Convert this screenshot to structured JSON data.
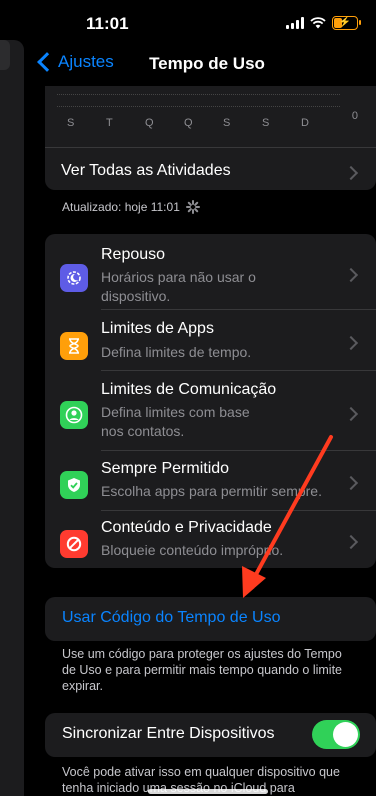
{
  "status": {
    "time": "11:01"
  },
  "nav": {
    "back_label": "Ajustes",
    "title": "Tempo de Uso"
  },
  "chart": {
    "days": [
      "S",
      "T",
      "Q",
      "Q",
      "S",
      "S",
      "D"
    ],
    "zero_label": "0"
  },
  "activities": {
    "label": "Ver Todas as Atividades"
  },
  "updated": {
    "text": "Atualizado: hoje 11:01"
  },
  "menu": [
    {
      "title": "Repouso",
      "subtitle": "Horários para não usar o dispositivo.",
      "icon": "moon-timer-icon",
      "color": "#5e5ce6"
    },
    {
      "title": "Limites de Apps",
      "subtitle": "Defina limites de tempo.",
      "icon": "hourglass-icon",
      "color": "#ff9f0a"
    },
    {
      "title": "Limites de Comunicação",
      "subtitle": "Defina limites com base nos contatos.",
      "icon": "person-circle-icon",
      "color": "#30d158"
    },
    {
      "title": "Sempre Permitido",
      "subtitle": "Escolha apps para permitir sempre.",
      "icon": "checkmark-shield-icon",
      "color": "#30d158"
    },
    {
      "title": "Conteúdo e Privacidade",
      "subtitle": "Bloqueie conteúdo impróprio.",
      "icon": "no-entry-icon",
      "color": "#ff3b30"
    }
  ],
  "passcode": {
    "link": "Usar Código do Tempo de Uso",
    "description": "Use um código para proteger os ajustes do Tempo de Uso e para permitir mais tempo quando o limite expirar."
  },
  "sync": {
    "label": "Sincronizar Entre Dispositivos",
    "enabled": true,
    "description": "Você pode ativar isso em qualquer dispositivo que tenha iniciado uma sessão no iCloud para"
  },
  "colors": {
    "accent": "#0a84ff",
    "toggle_on": "#30d158",
    "battery": "#ff9f0a"
  }
}
